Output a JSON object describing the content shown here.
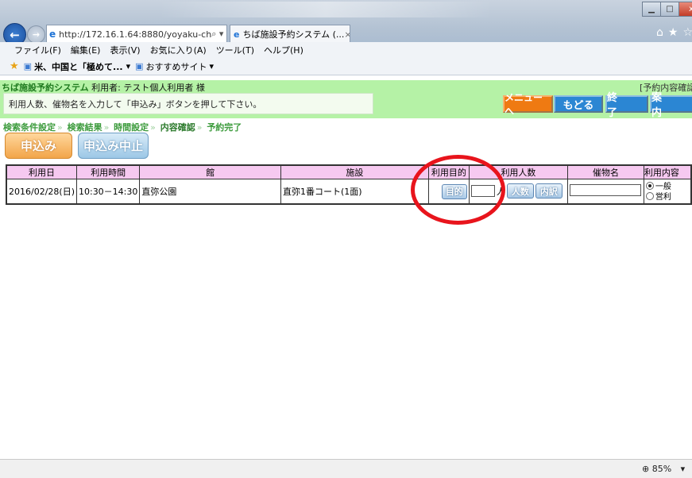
{
  "browser": {
    "address": "http://172.16.1.64:8880/yoyaku-ch",
    "address_host": "172.16.1.64",
    "tab_title": "ちば施設予約システム (...",
    "menu": [
      "ファイル(F)",
      "編集(E)",
      "表示(V)",
      "お気に入り(A)",
      "ツール(T)",
      "ヘルプ(H)"
    ],
    "favorites": [
      "米、中国と「極めて...",
      "おすすめサイト"
    ],
    "zoom": "85%"
  },
  "header": {
    "system_name": "ちば施設予約システム",
    "user": "利用者: テスト個人利用者 様",
    "page_label": "[予約内容確認",
    "instruction": "利用人数、催物名を入力して「申込み」ボタンを押して下さい。",
    "buttons": {
      "menu": "メニューへ",
      "back": "もどる",
      "end": "終 了",
      "guide": "案 内"
    }
  },
  "steps": [
    "検索条件設定",
    "検索結果",
    "時間設定",
    "内容確認",
    "予約完了"
  ],
  "steps_current": 3,
  "actions": {
    "apply": "申込み",
    "cancel": "申込み中止"
  },
  "table": {
    "headers": [
      "利用日",
      "利用時間",
      "館",
      "施設",
      "利用目的",
      "利用人数",
      "催物名",
      "利用内容"
    ],
    "row": {
      "date": "2016/02/28(日)",
      "time": "10:30－14:30",
      "hall": "直弥公園",
      "facility": "直弥1番コート(1面)",
      "purpose_button": "目的",
      "people_unit": "人",
      "people_button": "人数",
      "breakdown_button": "内訳",
      "usage_general": "一般",
      "usage_commercial": "営利"
    }
  }
}
